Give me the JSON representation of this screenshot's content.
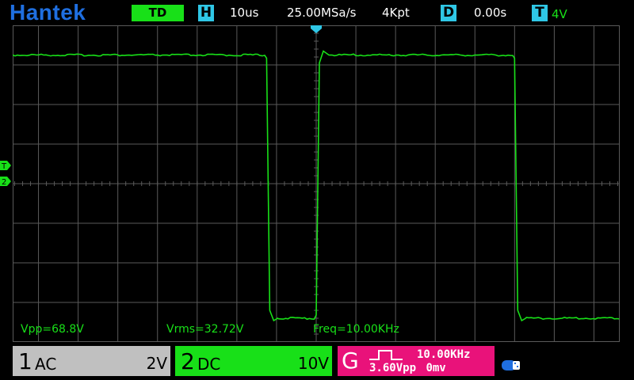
{
  "brand": "Hantek",
  "top": {
    "mode": "TD",
    "h_letter": "H",
    "timebase": "10us",
    "sample_rate": "25.00MSa/s",
    "memory_depth": "4Kpt",
    "d_letter": "D",
    "delay": "0.00s",
    "t_letter": "T",
    "trigger_level": "4V"
  },
  "markers": {
    "trigger": "T",
    "channel2": "2"
  },
  "measurements": {
    "vpp": "Vpp=68.8V",
    "vrms": "Vrms=32.72V",
    "freq": "Freq=10.00KHz"
  },
  "channels": [
    {
      "number": "1",
      "coupling": "AC",
      "scale": "2V"
    },
    {
      "number": "2",
      "coupling": "DC",
      "scale": "10V"
    }
  ],
  "generator": {
    "letter": "G",
    "frequency": "10.00KHz",
    "amplitude": "3.60Vpp",
    "offset": "0mv"
  },
  "colors": {
    "brand": "#1f6fe0",
    "channel2": "#18e018",
    "channel1_box": "#c0c0c0",
    "generator_box": "#e9127a",
    "badge": "#2fc7e6",
    "grid": "#5a5a5a"
  },
  "waveform": {
    "channel": "2",
    "type": "square",
    "high_level_div": 3.25,
    "low_level_div": -3.4,
    "edges_div": [
      [
        -1.25,
        "fall"
      ],
      [
        0,
        "rise"
      ],
      [
        5,
        "fall"
      ]
    ]
  }
}
